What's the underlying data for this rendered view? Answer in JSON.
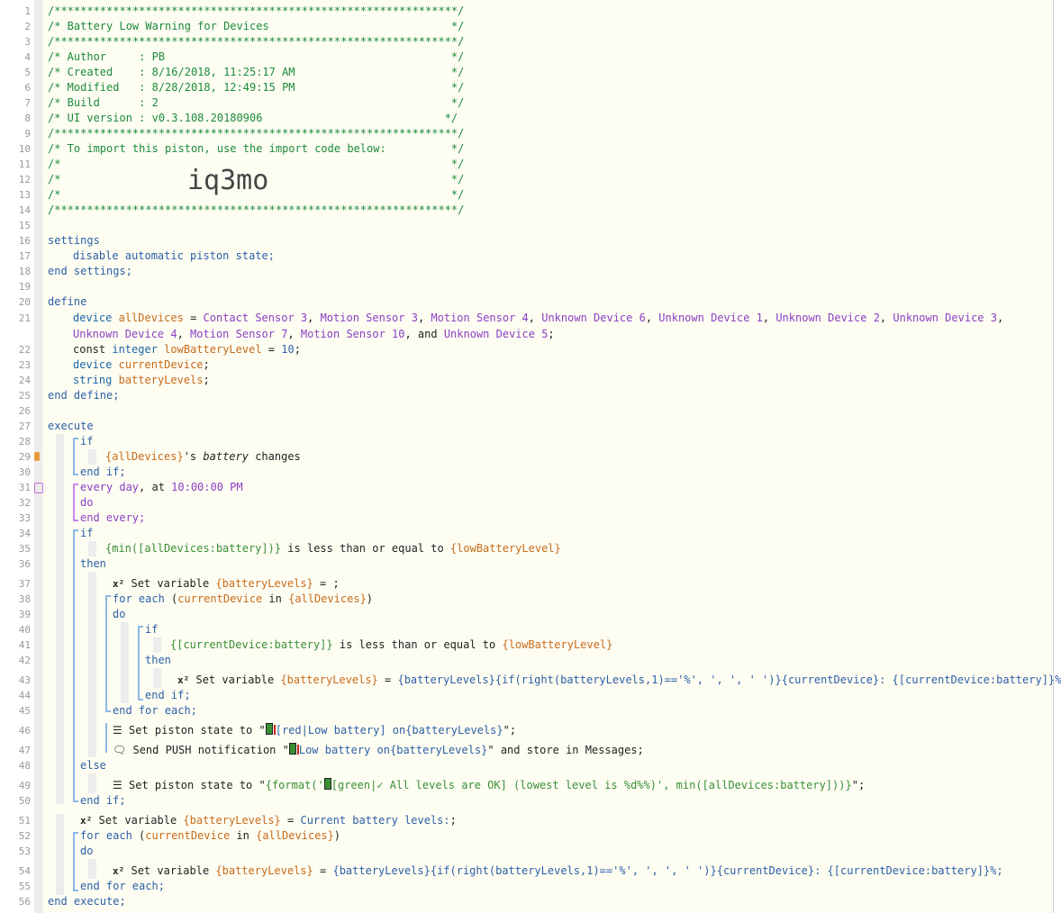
{
  "line_numbers": [
    "1",
    "2",
    "3",
    "4",
    "5",
    "6",
    "7",
    "8",
    "9",
    "10",
    "11",
    "12",
    "13",
    "14",
    "15",
    "16",
    "17",
    "18",
    "19",
    "20",
    "21",
    "22",
    "23",
    "24",
    "25",
    "26",
    "27",
    "28",
    "29",
    "30",
    "31",
    "32",
    "33",
    "34",
    "35",
    "36",
    "37",
    "38",
    "39",
    "40",
    "41",
    "42",
    "43",
    "44",
    "45",
    "46",
    "47",
    "48",
    "49",
    "50",
    "51",
    "52",
    "53",
    "54",
    "55",
    "56"
  ],
  "header": {
    "border": "/**************************************************************/",
    "title": "/* Battery Low Warning for Devices                            */",
    "author": "/* Author     : PB                                            */",
    "created": "/* Created    : 8/16/2018, 11:25:17 AM                        */",
    "modified": "/* Modified   : 8/28/2018, 12:49:15 PM                        */",
    "build": "/* Build      : 2                                             */",
    "ui_version": "/* UI version : v0.3.108.20180906                            */",
    "import_note": "/* To import this piston, use the import code below:          */",
    "blank": "/*                                                            */",
    "import_code": "iq3mo"
  },
  "code": {
    "settings": "settings",
    "disable": "disable automatic piston state;",
    "end_settings": "end settings;",
    "define": "define",
    "device_kw": "device",
    "all_devices": "allDevices",
    "eq": " = ",
    "dev1": "Contact Sensor 3",
    "dev2": "Motion Sensor 3",
    "dev3": "Motion Sensor 4",
    "dev4": "Unknown Device 6",
    "dev5": "Unknown Device 1",
    "dev6": "Unknown Device 2",
    "dev7": "Unknown Device 3",
    "dev8": "Unknown Device 4",
    "dev9": "Motion Sensor 7",
    "dev10": "Motion Sensor 10",
    "dev11": "Unknown Device 5",
    "comma": ", ",
    "and": ", and ",
    "semi": ";",
    "const": "const ",
    "integer": "integer",
    "low_battery_level": "lowBatteryLevel",
    "ten": "10",
    "current_device": "currentDevice",
    "string_kw": "string",
    "battery_levels": "batteryLevels",
    "end_define": "end define;",
    "execute": "execute",
    "if": "if",
    "all_devices_ref": "{allDevices}",
    "s_battery": "'s ",
    "battery": "battery",
    "changes": " changes",
    "end_if": "end if;",
    "every_day": "every day",
    "at": ", at ",
    "time": "10:00:00 PM",
    "do": "do",
    "end_every": "end every;",
    "min_expr": "{min([allDevices:battery])}",
    "lte": " is less than or equal to ",
    "low_ref": "{lowBatteryLevel}",
    "then": "then",
    "set_variable": "Set variable ",
    "bl_ref": "{batteryLevels}",
    "eq_semi": " = ;",
    "for_each": "for each ",
    "paren_open": "(",
    "in": " in ",
    "paren_close": ")",
    "cur_batt": "{[currentDevice:battery]}",
    "assign": " = ",
    "concat_expr": "{batteryLevels}{if(right(batteryLevels,1)=='%', ', ', ' ')}{currentDevice}: {[currentDevice:battery]}%;",
    "end_for_each": "end for each;",
    "set_state": "Set piston state to \"",
    "state_low": "[red|Low battery] on{batteryLevels}",
    "quote_semi": "\";",
    "send_push": "Send PUSH notification \"",
    "push_msg": "Low battery on{batteryLevels}",
    "store": "\" and store in Messages;",
    "else": "else",
    "format_pre": "{format('",
    "format_mid": "[green|✓ All levels are OK] (lowest level is %d%%)', min([allDevices:battery]))}",
    "current_battery_levels": "Current battery levels:",
    "end_execute": "end execute;",
    "x2": "x²"
  }
}
